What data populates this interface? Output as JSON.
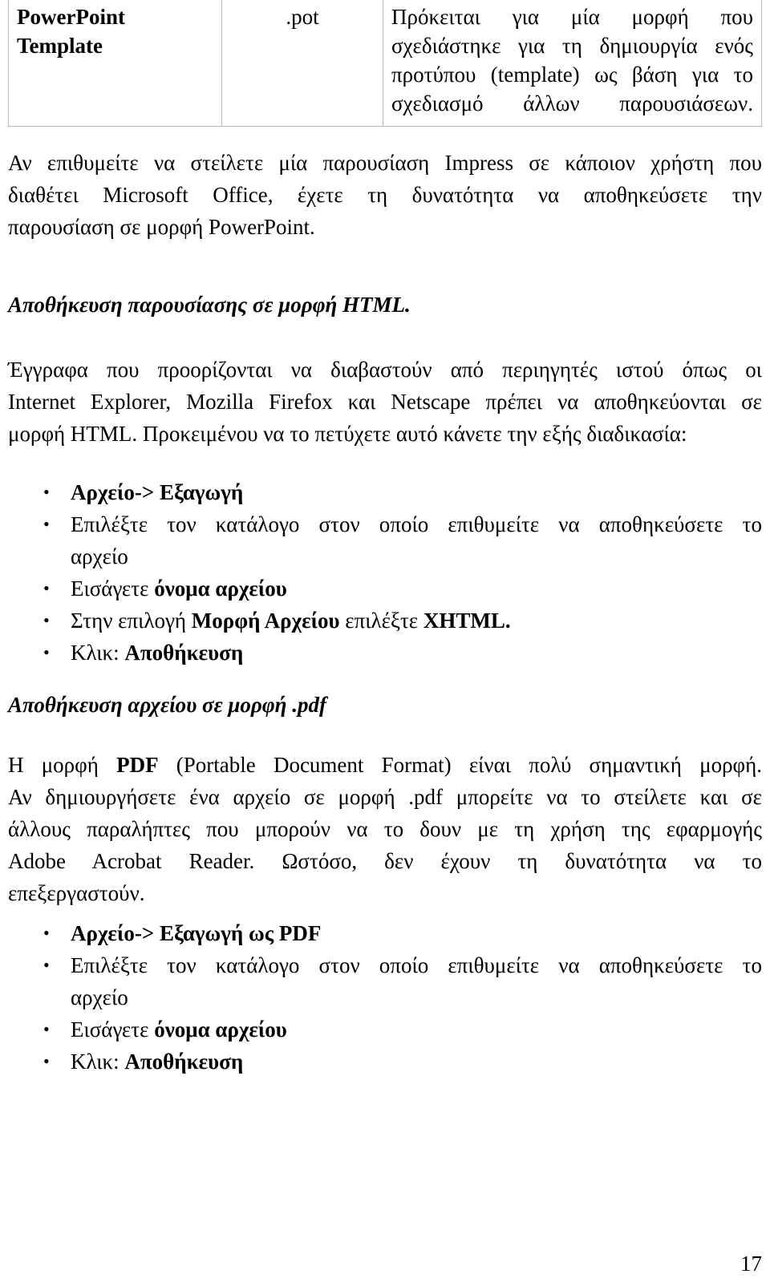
{
  "document": {
    "page_number": "17"
  },
  "format_table": {
    "rows": [
      {
        "name": "PowerPoint Template",
        "name_line1": "PowerPoint",
        "name_line2": "Template",
        "extension": ".pot",
        "description_lines": [
          "Πρόκειται για μία μορφή που",
          "σχεδιάστηκε για τη δημιουργία ενός",
          "προτύπου (template) ως βάση για το",
          "σχεδιασμό άλλων παρουσιάσεων."
        ]
      }
    ]
  },
  "intro_paragraph": {
    "lines": [
      "Αν επιθυμείτε να στείλετε μία παρουσίαση Impress σε κάποιον χρήστη που",
      "διαθέτει Microsoft Office, έχετε τη δυνατότητα να αποθηκεύσετε την",
      "παρουσίαση σε μορφή PowerPoint."
    ]
  },
  "html_section": {
    "heading": "Αποθήκευση παρουσίασης σε μορφή HTML.",
    "paragraph_lines": [
      "Έγγραφα που προορίζονται να διαβαστούν από περιηγητές ιστού όπως οι",
      "Internet Explorer, Mozilla Firefox και Netscape πρέπει να αποθηκεύονται σε",
      "μορφή HTML.  Προκειμένου να το πετύχετε αυτό κάνετε την εξής διαδικασία:"
    ],
    "steps": [
      {
        "bullet": "•",
        "bold_all": true,
        "text": "Αρχείο-> Εξαγωγή"
      },
      {
        "bullet": "•",
        "bold_all": false,
        "line1": "Επιλέξτε τον κατάλογο στον οποίο επιθυμείτε να αποθηκεύσετε το",
        "line2": "αρχείο"
      },
      {
        "bullet": "•",
        "bold_all": false,
        "prefix": "Εισάγετε ",
        "bold": "όνομα αρχείου",
        "suffix": ""
      },
      {
        "bullet": "•",
        "bold_all": false,
        "prefix": "Στην επιλογή ",
        "bold": "Μορφή Αρχείου",
        "middle": " επιλέξτε ",
        "bold2": "XHTML."
      },
      {
        "bullet": "•",
        "bold_all": false,
        "prefix": "Κλικ: ",
        "bold": "Αποθήκευση"
      }
    ]
  },
  "pdf_section": {
    "heading": "Αποθήκευση αρχείου σε μορφή .pdf",
    "paragraph": {
      "line1_prefix": "Η μορφή ",
      "line1_bold": "PDF",
      "line1_suffix": " (Portable Document Format) είναι πολύ σημαντική μορφή.",
      "line2": "Αν δημιουργήσετε ένα αρχείο σε μορφή .pdf μπορείτε να το στείλετε και σε",
      "line3": "άλλους παραλήπτες που μπορούν να το δουν με τη χρήση της εφαρμογής",
      "line4": "Adobe Acrobat Reader.   Ωστόσο, δεν έχουν τη δυνατότητα να το",
      "line5": "επεξεργαστούν."
    },
    "steps": [
      {
        "bullet": "•",
        "bold_all": true,
        "text": "Αρχείο-> Εξαγωγή ως PDF"
      },
      {
        "bullet": "•",
        "bold_all": false,
        "line1": "Επιλέξτε τον κατάλογο στον οποίο επιθυμείτε να αποθηκεύσετε το",
        "line2": "αρχείο"
      },
      {
        "bullet": "•",
        "bold_all": false,
        "prefix": "Εισάγετε ",
        "bold": "όνομα αρχείου"
      },
      {
        "bullet": "•",
        "bold_all": false,
        "prefix": "Κλικ: ",
        "bold": "Αποθήκευση"
      }
    ]
  }
}
